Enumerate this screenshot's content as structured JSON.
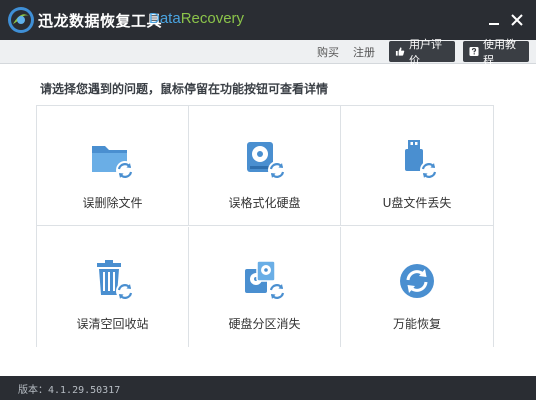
{
  "app": {
    "title": "迅龙数据恢复工具",
    "subtitle_a": "Data",
    "subtitle_b": "Recovery"
  },
  "toolbar": {
    "buy": "购买",
    "register": "注册",
    "user_review": "用户评价",
    "tutorial": "使用教程"
  },
  "prompt": "请选择您遇到的问题，鼠标停留在功能按钮可查看详情",
  "features": [
    {
      "label": "误删除文件",
      "icon": "folder-restore-icon"
    },
    {
      "label": "误格式化硬盘",
      "icon": "harddisk-restore-icon"
    },
    {
      "label": "U盘文件丢失",
      "icon": "usb-restore-icon"
    },
    {
      "label": "误清空回收站",
      "icon": "recycle-bin-restore-icon"
    },
    {
      "label": "硬盘分区消失",
      "icon": "partition-restore-icon"
    },
    {
      "label": "万能恢复",
      "icon": "universal-restore-icon"
    }
  ],
  "status": {
    "version": "版本：4.1.29.50317"
  },
  "colors": {
    "titlebar": "#2a2d33",
    "accent_blue": "#4aa3e0",
    "accent_green": "#8bc34a",
    "icon_blue": "#4a8fd0"
  }
}
